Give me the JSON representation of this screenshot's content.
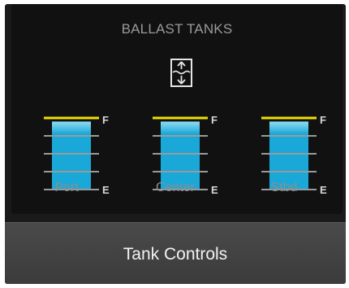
{
  "panel": {
    "title": "BALLAST TANKS",
    "mode_icon": "ballast-fill-drain-icon"
  },
  "scale": {
    "full": "F",
    "empty": "E"
  },
  "tanks": [
    {
      "label": "Port",
      "level_fraction": 0.95
    },
    {
      "label": "Center",
      "level_fraction": 0.95
    },
    {
      "label": "Stbd",
      "level_fraction": 0.95
    }
  ],
  "colors": {
    "fill": "#1aa8d9",
    "fill_top": "#8fdcf2",
    "full_marker": "#f0e000",
    "tick": "#9a9a9a"
  },
  "controls": {
    "button_label": "Tank Controls"
  }
}
